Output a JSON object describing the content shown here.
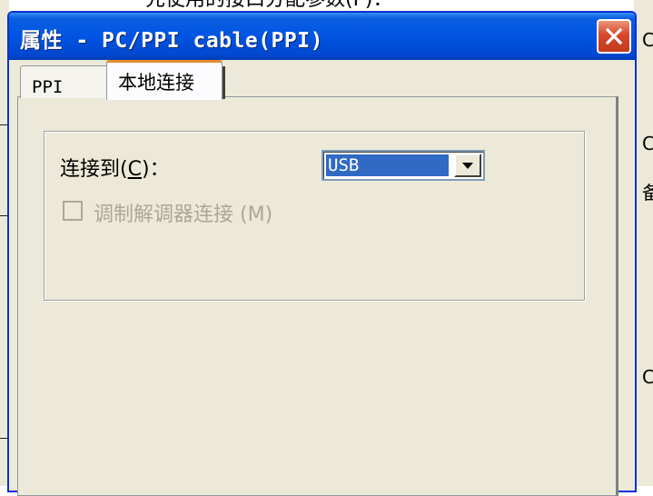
{
  "background": {
    "top_text": "先使用的接口分配参数(P)：",
    "right_chars": [
      "C",
      "C",
      "备",
      "C"
    ]
  },
  "dialog": {
    "title": "属性 - PC/PPI cable(PPI)",
    "close_icon": "close-icon"
  },
  "tabs": [
    {
      "label": "PPI",
      "selected": false
    },
    {
      "label": "本地连接",
      "selected": true
    }
  ],
  "local_connection": {
    "connect_to_label": "连接到",
    "connect_to_mnemonic": "C",
    "connect_to_suffix": ")：",
    "connect_to_value": "USB",
    "modem_label": "调制解调器连接",
    "modem_mnemonic": "(M)",
    "modem_checked": false,
    "modem_enabled": false
  },
  "colors": {
    "titlebar": "#0054e3",
    "selection": "#316ac5",
    "active_tab_accent": "#e68b2c",
    "disabled_text": "#aca899"
  }
}
